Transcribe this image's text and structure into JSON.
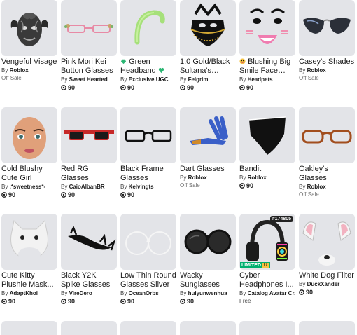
{
  "robux_icon": "robux-icon",
  "items": [
    {
      "name": "Vengeful Visage",
      "by": "Roblox",
      "price": "Off Sale",
      "type": "offsale",
      "icon": "stone-mask-icon"
    },
    {
      "name": "Pink Mori Kei Button Glasses",
      "by": "Sweet Hearted",
      "price": "90",
      "type": "robux",
      "icon": "pink-glasses-icon"
    },
    {
      "name": "Green Headband",
      "by": "Exclusive UGC",
      "price": "90",
      "type": "robux",
      "icon": "green-headband-icon"
    },
    {
      "name": "1.0 Gold/Black Sultana's Royal...",
      "by": "Felgrim",
      "price": "90",
      "type": "robux",
      "icon": "black-gold-veil-icon"
    },
    {
      "name": "Blushing Big Smile Face (3D...",
      "by": "Headpets",
      "price": "90",
      "type": "robux",
      "icon": "smile-face-icon"
    },
    {
      "name": "Casey's Shades",
      "by": "Roblox",
      "price": "Off Sale",
      "type": "offsale",
      "icon": "shades-icon"
    },
    {
      "name": "Cold Blushy Cute Girl",
      "by": ".*sweetness*-",
      "price": "90",
      "type": "robux",
      "icon": "girl-face-icon"
    },
    {
      "name": "Red RG Glasses",
      "by": "CaioAlbanBR",
      "price": "90",
      "type": "robux",
      "icon": "red-glasses-icon"
    },
    {
      "name": "Black Frame Glasses",
      "by": "Kelvingts",
      "price": "90",
      "type": "robux",
      "icon": "black-frame-glasses-icon"
    },
    {
      "name": "Dart Glasses",
      "by": "Roblox",
      "price": "Off Sale",
      "type": "offsale",
      "icon": "dart-glasses-icon"
    },
    {
      "name": "Bandit",
      "by": "Roblox",
      "price": "90",
      "type": "robux",
      "icon": "bandit-mask-icon"
    },
    {
      "name": "Oakley's Glasses",
      "by": "Roblox",
      "price": "Off Sale",
      "type": "offsale",
      "icon": "brown-glasses-icon"
    },
    {
      "name": "Cute Kitty Plushie Mask...",
      "by": "AdaptKhoi",
      "price": "90",
      "type": "robux",
      "icon": "kitty-mask-icon"
    },
    {
      "name": "Black Y2K Spike Glasses",
      "by": "VireDero",
      "price": "90",
      "type": "robux",
      "icon": "spike-glasses-icon"
    },
    {
      "name": "Low Thin Round Glasses Silver",
      "by": "OceanOrbs",
      "price": "90",
      "type": "robux",
      "icon": "round-glasses-icon"
    },
    {
      "name": "Wacky Sunglasses",
      "by": "huiyunwenhua",
      "price": "90",
      "type": "robux",
      "icon": "wacky-sunglasses-icon"
    },
    {
      "name": "Cyber Headphones I...",
      "by": "Catalog Avatar Cr...",
      "price": "Free",
      "type": "free",
      "icon": "headphones-icon",
      "limited_label": "LIMITED",
      "limited_u": "U",
      "serial": "#174805"
    },
    {
      "name": "White Dog Filter",
      "by": "DuckXander",
      "price": "90",
      "type": "robux",
      "icon": "dog-filter-icon"
    }
  ],
  "by_prefix": "By"
}
